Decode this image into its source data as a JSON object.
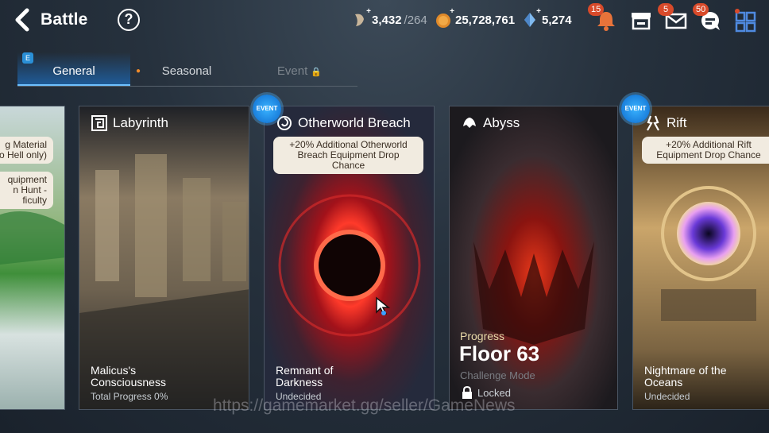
{
  "header": {
    "title": "Battle",
    "help_label": "?",
    "stamina": "3,432",
    "stamina_max": "/264",
    "gold": "25,728,761",
    "crystals": "5,274",
    "notifications_badge": "15",
    "mail_badge": "5",
    "chat_badge": "50"
  },
  "tabs": [
    {
      "label": "General",
      "mark": "E"
    },
    {
      "label": "Seasonal"
    },
    {
      "label": "Event",
      "lock": "🔒"
    }
  ],
  "cards": {
    "hell": {
      "bonus1": "g Material\no Hell only)",
      "bonus2": "quipment\nn Hunt -\nficulty"
    },
    "labyrinth": {
      "title": "Labyrinth",
      "name": "Malicus's\nConsciousness",
      "sub": "Total Progress 0%"
    },
    "breach": {
      "badge": "EVENT",
      "title": "Otherworld Breach",
      "bonus": "+20% Additional Otherworld\nBreach Equipment Drop\nChance",
      "name": "Remnant of\nDarkness",
      "sub": "Undecided"
    },
    "abyss": {
      "title": "Abyss",
      "progress_label": "Progress",
      "floor": "Floor 63",
      "mode": "Challenge Mode",
      "status": "Locked"
    },
    "rift": {
      "badge": "EVENT",
      "title": "Rift",
      "bonus": "+20% Additional Rift\nEquipment Drop Chance",
      "name": "Nightmare of the\nOceans",
      "sub": "Undecided"
    }
  },
  "watermark": "https://gamemarket.gg/seller/GameNews",
  "colors": {
    "accent": "#1f5a96",
    "badge": "#d84a2a",
    "event": "#1a7fdc"
  }
}
